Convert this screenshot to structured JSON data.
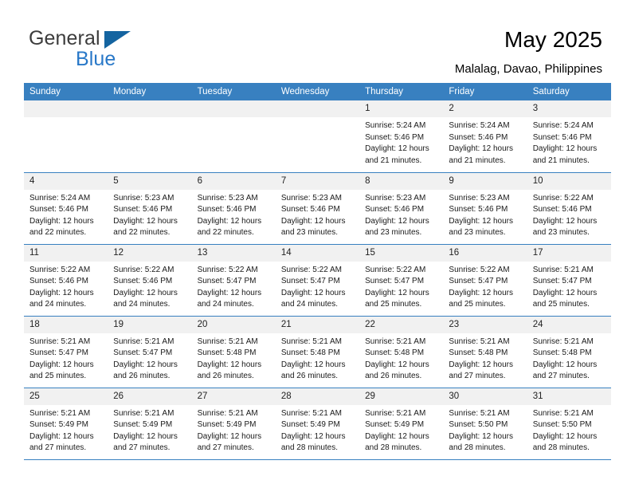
{
  "brand": {
    "line1": "General",
    "line2": "Blue",
    "triangle_color": "#1464a0",
    "line2_color": "#2878c8"
  },
  "header": {
    "title": "May 2025",
    "subtitle": "Malalag, Davao, Philippines"
  },
  "theme": {
    "header_bg": "#3880c0",
    "header_text": "#ffffff",
    "cell_num_bg": "#f1f1f1",
    "grid_line": "#3880c0"
  },
  "calendar": {
    "weekday_headers": [
      "Sunday",
      "Monday",
      "Tuesday",
      "Wednesday",
      "Thursday",
      "Friday",
      "Saturday"
    ],
    "weeks": [
      [
        {
          "day": "",
          "sunrise": "",
          "sunset": "",
          "daylight1": "",
          "daylight2": "",
          "empty": true
        },
        {
          "day": "",
          "sunrise": "",
          "sunset": "",
          "daylight1": "",
          "daylight2": "",
          "empty": true
        },
        {
          "day": "",
          "sunrise": "",
          "sunset": "",
          "daylight1": "",
          "daylight2": "",
          "empty": true
        },
        {
          "day": "",
          "sunrise": "",
          "sunset": "",
          "daylight1": "",
          "daylight2": "",
          "empty": true
        },
        {
          "day": "1",
          "sunrise": "Sunrise: 5:24 AM",
          "sunset": "Sunset: 5:46 PM",
          "daylight1": "Daylight: 12 hours",
          "daylight2": "and 21 minutes.",
          "empty": false
        },
        {
          "day": "2",
          "sunrise": "Sunrise: 5:24 AM",
          "sunset": "Sunset: 5:46 PM",
          "daylight1": "Daylight: 12 hours",
          "daylight2": "and 21 minutes.",
          "empty": false
        },
        {
          "day": "3",
          "sunrise": "Sunrise: 5:24 AM",
          "sunset": "Sunset: 5:46 PM",
          "daylight1": "Daylight: 12 hours",
          "daylight2": "and 21 minutes.",
          "empty": false
        }
      ],
      [
        {
          "day": "4",
          "sunrise": "Sunrise: 5:24 AM",
          "sunset": "Sunset: 5:46 PM",
          "daylight1": "Daylight: 12 hours",
          "daylight2": "and 22 minutes.",
          "empty": false
        },
        {
          "day": "5",
          "sunrise": "Sunrise: 5:23 AM",
          "sunset": "Sunset: 5:46 PM",
          "daylight1": "Daylight: 12 hours",
          "daylight2": "and 22 minutes.",
          "empty": false
        },
        {
          "day": "6",
          "sunrise": "Sunrise: 5:23 AM",
          "sunset": "Sunset: 5:46 PM",
          "daylight1": "Daylight: 12 hours",
          "daylight2": "and 22 minutes.",
          "empty": false
        },
        {
          "day": "7",
          "sunrise": "Sunrise: 5:23 AM",
          "sunset": "Sunset: 5:46 PM",
          "daylight1": "Daylight: 12 hours",
          "daylight2": "and 23 minutes.",
          "empty": false
        },
        {
          "day": "8",
          "sunrise": "Sunrise: 5:23 AM",
          "sunset": "Sunset: 5:46 PM",
          "daylight1": "Daylight: 12 hours",
          "daylight2": "and 23 minutes.",
          "empty": false
        },
        {
          "day": "9",
          "sunrise": "Sunrise: 5:23 AM",
          "sunset": "Sunset: 5:46 PM",
          "daylight1": "Daylight: 12 hours",
          "daylight2": "and 23 minutes.",
          "empty": false
        },
        {
          "day": "10",
          "sunrise": "Sunrise: 5:22 AM",
          "sunset": "Sunset: 5:46 PM",
          "daylight1": "Daylight: 12 hours",
          "daylight2": "and 23 minutes.",
          "empty": false
        }
      ],
      [
        {
          "day": "11",
          "sunrise": "Sunrise: 5:22 AM",
          "sunset": "Sunset: 5:46 PM",
          "daylight1": "Daylight: 12 hours",
          "daylight2": "and 24 minutes.",
          "empty": false
        },
        {
          "day": "12",
          "sunrise": "Sunrise: 5:22 AM",
          "sunset": "Sunset: 5:46 PM",
          "daylight1": "Daylight: 12 hours",
          "daylight2": "and 24 minutes.",
          "empty": false
        },
        {
          "day": "13",
          "sunrise": "Sunrise: 5:22 AM",
          "sunset": "Sunset: 5:47 PM",
          "daylight1": "Daylight: 12 hours",
          "daylight2": "and 24 minutes.",
          "empty": false
        },
        {
          "day": "14",
          "sunrise": "Sunrise: 5:22 AM",
          "sunset": "Sunset: 5:47 PM",
          "daylight1": "Daylight: 12 hours",
          "daylight2": "and 24 minutes.",
          "empty": false
        },
        {
          "day": "15",
          "sunrise": "Sunrise: 5:22 AM",
          "sunset": "Sunset: 5:47 PM",
          "daylight1": "Daylight: 12 hours",
          "daylight2": "and 25 minutes.",
          "empty": false
        },
        {
          "day": "16",
          "sunrise": "Sunrise: 5:22 AM",
          "sunset": "Sunset: 5:47 PM",
          "daylight1": "Daylight: 12 hours",
          "daylight2": "and 25 minutes.",
          "empty": false
        },
        {
          "day": "17",
          "sunrise": "Sunrise: 5:21 AM",
          "sunset": "Sunset: 5:47 PM",
          "daylight1": "Daylight: 12 hours",
          "daylight2": "and 25 minutes.",
          "empty": false
        }
      ],
      [
        {
          "day": "18",
          "sunrise": "Sunrise: 5:21 AM",
          "sunset": "Sunset: 5:47 PM",
          "daylight1": "Daylight: 12 hours",
          "daylight2": "and 25 minutes.",
          "empty": false
        },
        {
          "day": "19",
          "sunrise": "Sunrise: 5:21 AM",
          "sunset": "Sunset: 5:47 PM",
          "daylight1": "Daylight: 12 hours",
          "daylight2": "and 26 minutes.",
          "empty": false
        },
        {
          "day": "20",
          "sunrise": "Sunrise: 5:21 AM",
          "sunset": "Sunset: 5:48 PM",
          "daylight1": "Daylight: 12 hours",
          "daylight2": "and 26 minutes.",
          "empty": false
        },
        {
          "day": "21",
          "sunrise": "Sunrise: 5:21 AM",
          "sunset": "Sunset: 5:48 PM",
          "daylight1": "Daylight: 12 hours",
          "daylight2": "and 26 minutes.",
          "empty": false
        },
        {
          "day": "22",
          "sunrise": "Sunrise: 5:21 AM",
          "sunset": "Sunset: 5:48 PM",
          "daylight1": "Daylight: 12 hours",
          "daylight2": "and 26 minutes.",
          "empty": false
        },
        {
          "day": "23",
          "sunrise": "Sunrise: 5:21 AM",
          "sunset": "Sunset: 5:48 PM",
          "daylight1": "Daylight: 12 hours",
          "daylight2": "and 27 minutes.",
          "empty": false
        },
        {
          "day": "24",
          "sunrise": "Sunrise: 5:21 AM",
          "sunset": "Sunset: 5:48 PM",
          "daylight1": "Daylight: 12 hours",
          "daylight2": "and 27 minutes.",
          "empty": false
        }
      ],
      [
        {
          "day": "25",
          "sunrise": "Sunrise: 5:21 AM",
          "sunset": "Sunset: 5:49 PM",
          "daylight1": "Daylight: 12 hours",
          "daylight2": "and 27 minutes.",
          "empty": false
        },
        {
          "day": "26",
          "sunrise": "Sunrise: 5:21 AM",
          "sunset": "Sunset: 5:49 PM",
          "daylight1": "Daylight: 12 hours",
          "daylight2": "and 27 minutes.",
          "empty": false
        },
        {
          "day": "27",
          "sunrise": "Sunrise: 5:21 AM",
          "sunset": "Sunset: 5:49 PM",
          "daylight1": "Daylight: 12 hours",
          "daylight2": "and 27 minutes.",
          "empty": false
        },
        {
          "day": "28",
          "sunrise": "Sunrise: 5:21 AM",
          "sunset": "Sunset: 5:49 PM",
          "daylight1": "Daylight: 12 hours",
          "daylight2": "and 28 minutes.",
          "empty": false
        },
        {
          "day": "29",
          "sunrise": "Sunrise: 5:21 AM",
          "sunset": "Sunset: 5:49 PM",
          "daylight1": "Daylight: 12 hours",
          "daylight2": "and 28 minutes.",
          "empty": false
        },
        {
          "day": "30",
          "sunrise": "Sunrise: 5:21 AM",
          "sunset": "Sunset: 5:50 PM",
          "daylight1": "Daylight: 12 hours",
          "daylight2": "and 28 minutes.",
          "empty": false
        },
        {
          "day": "31",
          "sunrise": "Sunrise: 5:21 AM",
          "sunset": "Sunset: 5:50 PM",
          "daylight1": "Daylight: 12 hours",
          "daylight2": "and 28 minutes.",
          "empty": false
        }
      ]
    ]
  }
}
